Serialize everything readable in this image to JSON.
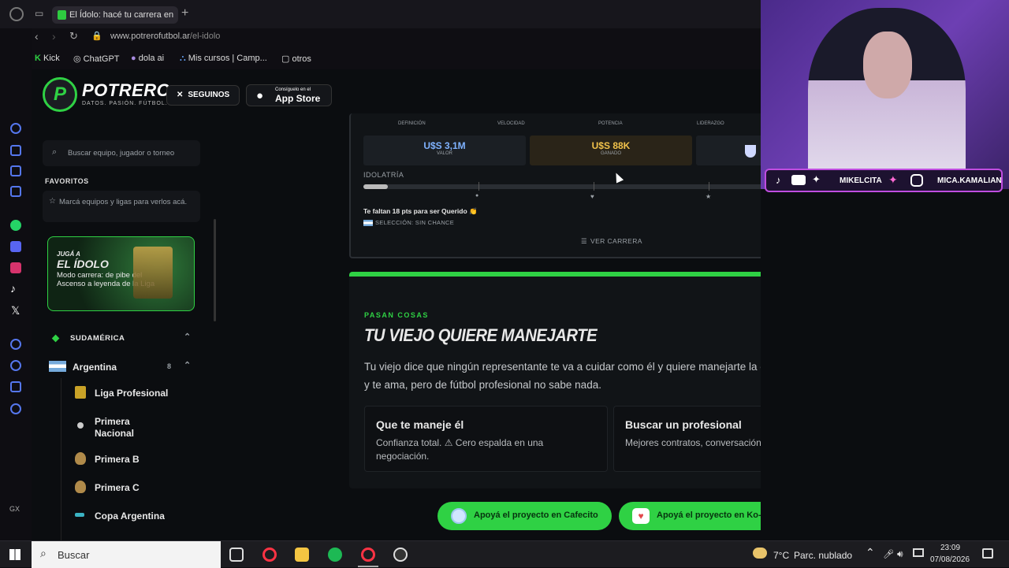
{
  "browser": {
    "tab_title": "El Ídolo: hacé tu carrera en",
    "new_tab": "+",
    "url_host": "www.potrerofutbol.ar",
    "url_path": "/el-idolo",
    "bookmarks": [
      "Kick",
      "ChatGPT",
      "dola ai",
      "Mis cursos | Camp...",
      "otros"
    ]
  },
  "header": {
    "brand": "POTRERO",
    "tagline": "DATOS. PASIÓN. FÚTBOL.",
    "follow_label": "SEGUINOS",
    "appstore_small": "Consíguelo en el",
    "appstore_big": "App Store"
  },
  "sidebar": {
    "search_placeholder": "Buscar equipo, jugador o torneo",
    "favorites_title": "FAVORITOS",
    "favorites_hint": "Marcá equipos y ligas para verlos acá.",
    "promo": {
      "kicker": "JUGÁ A",
      "title": "EL ÍDOLO",
      "desc": "Modo carrera: de pibe del Ascenso a leyenda de la Liga"
    },
    "region": "SUDAMÉRICA",
    "country": "Argentina",
    "country_count": "8",
    "leagues": [
      "Liga Profesional",
      "Primera Nacional",
      "Primera B",
      "Primera C",
      "Copa Argentina"
    ]
  },
  "career": {
    "attr_labels": [
      "DEFINICIÓN",
      "VELOCIDAD",
      "POTENCIA",
      "LIDERAZGO"
    ],
    "value_amount": "U$S 3,1M",
    "value_label": "VALOR",
    "earned_amount": "U$S 88K",
    "earned_label": "GANADO",
    "idolatry_label": "IDOLATRÍA",
    "idolatry_progress": 0.06,
    "pts_text": "Te faltan 18 pts para ser Querido 👏",
    "selection_text": "SELECCIÓN: SIN CHANCE",
    "view_career": "VER CARRERA"
  },
  "event": {
    "kicker": "PASAN COSAS",
    "title": "TU VIEJO QUIERE MANEJARTE",
    "body": "Tu viejo dice que ningún representante te va a cuidar como él y quiere manejarte la carrera. Es tu papá y te ama, pero de fútbol profesional no sabe nada.",
    "options": [
      {
        "title": "Que te maneje él",
        "desc": "Confianza total. ⚠ Cero espalda en una negociación."
      },
      {
        "title": "Buscar un profesional",
        "desc": "Mejores contratos, conversación difícil."
      }
    ]
  },
  "support": {
    "cafecito": "Apoyá el proyecto en Cafecito",
    "kofi": "Apoyá el proyecto en Ko-Fi"
  },
  "overlay": {
    "handle1": "MIKELCITA",
    "handle2": "MICA.KAMALIAN"
  },
  "taskbar": {
    "search": "Buscar",
    "temp": "7°C",
    "weather": "Parc. nublado",
    "time": "23:09",
    "date": "07/08/2026"
  },
  "colors": {
    "accent": "#2fd144",
    "bg": "#0b0d10",
    "overlay_border": "#c04de0"
  }
}
